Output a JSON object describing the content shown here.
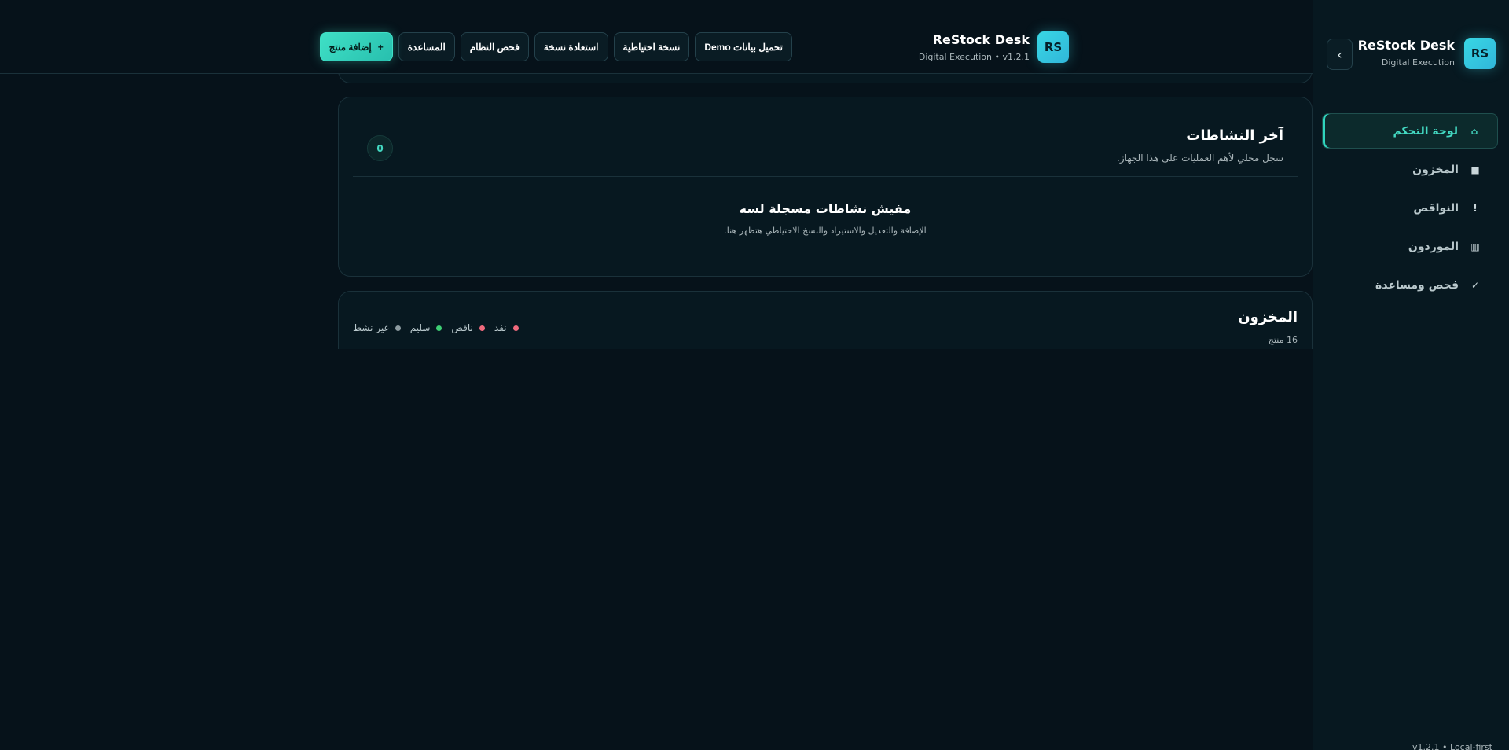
{
  "brand": {
    "initials": "RS",
    "title": "ReStock Desk",
    "subtitle": "Digital Execution",
    "header_subtitle": "Digital Execution • v1.2.1"
  },
  "sidebar": {
    "collapse_icon": "›",
    "items": [
      {
        "label": "لوحة التحكم",
        "icon": "⌂",
        "icon_name": "home-icon",
        "active": true
      },
      {
        "label": "المخزون",
        "icon": "■",
        "icon_name": "box-icon",
        "active": false
      },
      {
        "label": "النواقص",
        "icon": "!",
        "icon_name": "alert-icon",
        "active": false
      },
      {
        "label": "الموردون",
        "icon": "▥",
        "icon_name": "suppliers-icon",
        "active": false
      },
      {
        "label": "فحص ومساعدة",
        "icon": "✓",
        "icon_name": "check-icon",
        "active": false
      }
    ],
    "footer": "v1.2.1 • Local-first"
  },
  "toolbar": {
    "load_demo": "تحميل بيانات Demo",
    "backup": "نسخة احتياطية",
    "restore": "استعادة نسخة",
    "system_check": "فحص النظام",
    "help": "المساعدة",
    "add_product": "إضافة منتج",
    "add_icon": "+"
  },
  "activity": {
    "title": "آخر النشاطات",
    "subtitle": "سجل محلي لأهم العمليات على هذا الجهاز.",
    "count": "0",
    "empty_title": "مفيش نشاطات مسجلة لسه",
    "empty_subtitle": "الإضافة والتعديل والاستيراد والنسخ الاحتياطي هتظهر هنا."
  },
  "inventory": {
    "title": "المخزون",
    "count_label": "16 منتج",
    "legend": [
      {
        "label": "نفد",
        "color": "#f06a7d"
      },
      {
        "label": "ناقص",
        "color": "#f06a7d"
      },
      {
        "label": "سليم",
        "color": "#3ecf74"
      },
      {
        "label": "غير نشط",
        "color": "#8d9ba0"
      }
    ]
  },
  "colors": {
    "accent": "#43d9c2",
    "background": "#06121a",
    "danger": "#f06a7d",
    "success": "#3ecf74",
    "muted": "#8d9ba0"
  }
}
